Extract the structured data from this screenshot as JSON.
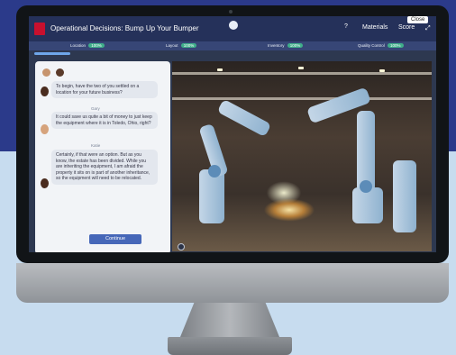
{
  "app": {
    "title": "Operational Decisions: Bump Up Your Bumper",
    "materials_label": "Materials",
    "score_label": "Score",
    "close_label": "Close",
    "help_icon": "help-icon",
    "expand_icon": "expand-icon"
  },
  "metrics": [
    {
      "label": "Location",
      "value": "100%"
    },
    {
      "label": "Layout",
      "value": "100%"
    },
    {
      "label": "Inventory",
      "value": "100%"
    },
    {
      "label": "Quality Control",
      "value": "100%"
    }
  ],
  "chat": {
    "messages": [
      {
        "speaker": "",
        "text": "To begin, have the two of you settled on a location for your future business?"
      },
      {
        "speaker": "Gary",
        "text": "It could save us quite a bit of money to just keep the equipment where it is in Toledo, Ohio, right?"
      },
      {
        "speaker": "Katie",
        "text": "Certainly, if that were an option. But as you know, the estate has been divided. While you are inheriting the equipment, I am afraid the property it sits on is part of another inheritance, so the equipment will need to be relocated."
      }
    ],
    "continue_label": "Continue"
  },
  "colors": {
    "accent": "#4667b8",
    "metric_pill": "#3fae8a",
    "topbar": "#25315a",
    "brand_red": "#c8102e"
  }
}
